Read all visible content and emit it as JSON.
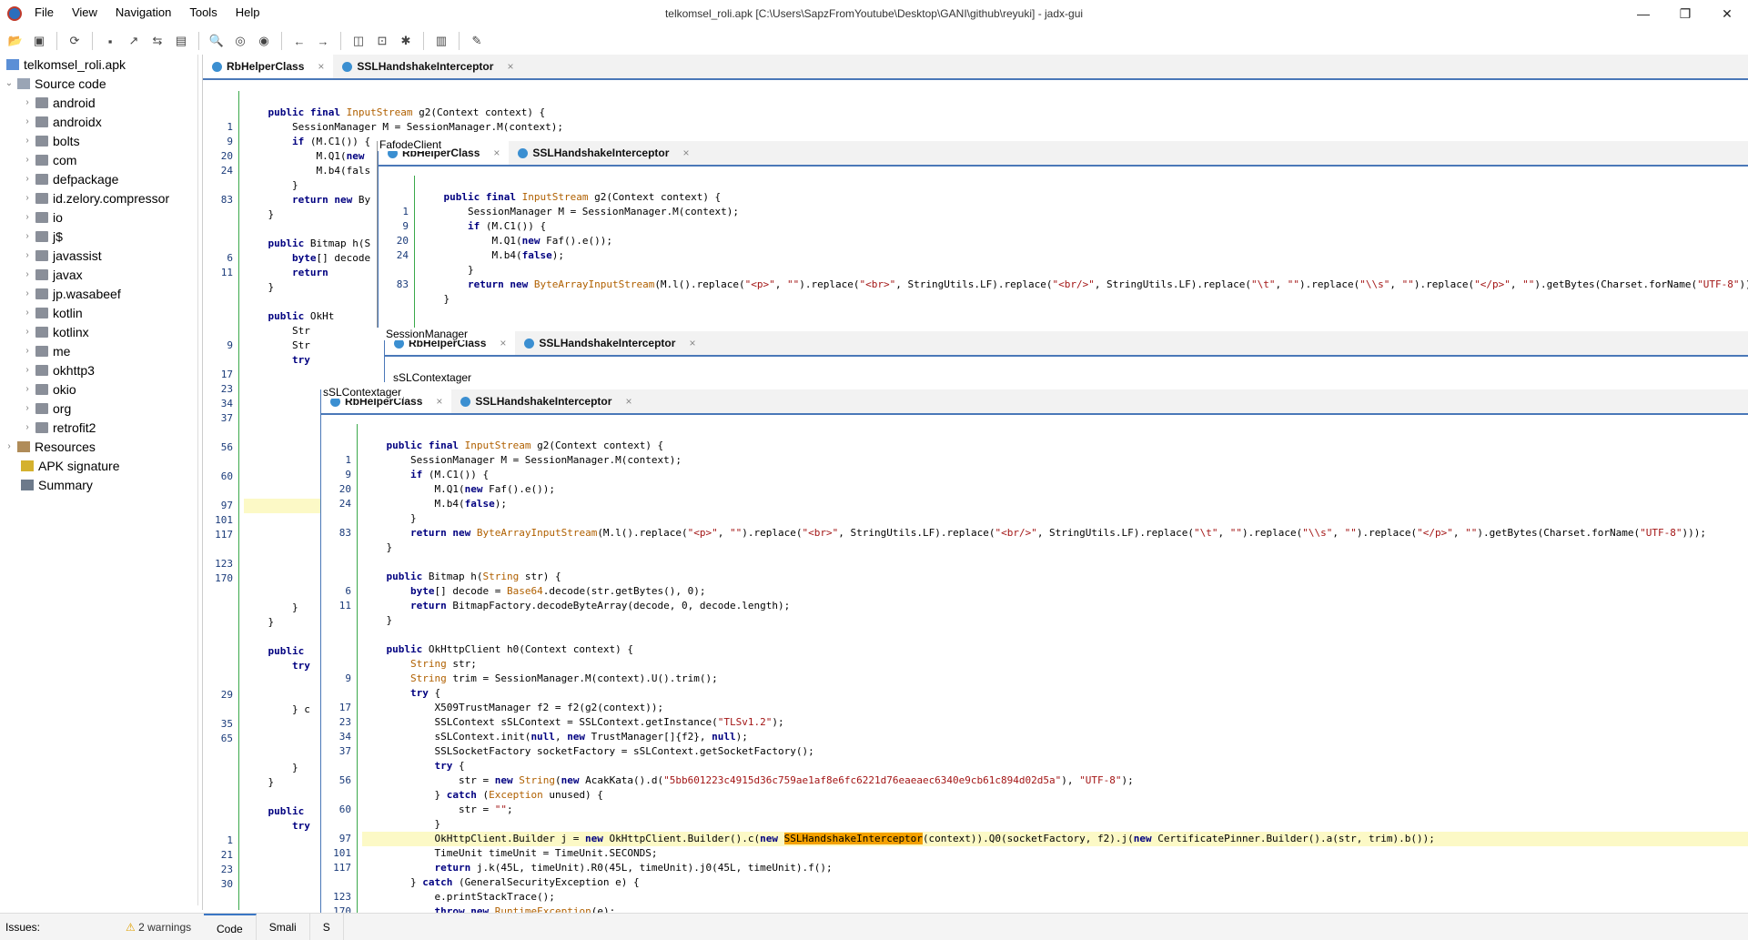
{
  "window": {
    "title": "telkomsel_roli.apk [C:\\Users\\SapzFromYoutube\\Desktop\\GANI\\github\\reyuki] - jadx-gui",
    "minimize": "—",
    "maximize": "❐",
    "close": "✕"
  },
  "menu": [
    "File",
    "View",
    "Navigation",
    "Tools",
    "Help"
  ],
  "tree": {
    "root": "telkomsel_roli.apk",
    "source": "Source code",
    "packages": [
      "android",
      "androidx",
      "bolts",
      "com",
      "defpackage",
      "id.zelory.compressor",
      "io",
      "j$",
      "javassist",
      "javax",
      "jp.wasabeef",
      "kotlin",
      "kotlinx",
      "me",
      "okhttp3",
      "okio",
      "org",
      "retrofit2"
    ],
    "resources": "Resources",
    "signature": "APK signature",
    "summary": "Summary"
  },
  "status": {
    "issues": "Issues:",
    "warnings": "2 warnings",
    "warn_icon": "⚠",
    "tabs": [
      "Code",
      "Smali",
      "S"
    ]
  },
  "tabs": {
    "helper": "RbHelperClass",
    "ssl": "SSLHandshakeInterceptor",
    "close": "×"
  },
  "floating_labels": {
    "fafode": "FafodeClient",
    "session": "SessionManager",
    "sslctx": "sSLContextager",
    "sslctx2": "sSLContextager"
  },
  "code": {
    "lines": [
      {
        "n": "",
        "t": ""
      },
      {
        "n": "",
        "t": "    public final InputStream g2(Context context) {"
      },
      {
        "n": "1",
        "t": "        SessionManager M = SessionManager.M(context);"
      },
      {
        "n": "9",
        "t": "        if (M.C1()) {"
      },
      {
        "n": "20",
        "t": "            M.Q1(new Faf().e());"
      },
      {
        "n": "24",
        "t": "            M.b4(false);"
      },
      {
        "n": "",
        "t": "        }"
      },
      {
        "n": "83",
        "t": "        return new ByteArrayInputStream(M.l().replace(\"<p>\", \"\").replace(\"<br>\", StringUtils.LF).replace(\"<br/>\", StringUtils.LF).replace(\"\\t\", \"\").replace(\"\\\\s\", \"\").replace(\"</p>\", \"\").getBytes(Charset.forName(\"UTF-8\")));"
      },
      {
        "n": "",
        "t": "    }"
      },
      {
        "n": "",
        "t": ""
      },
      {
        "n": "",
        "t": "    public Bitmap h(String str) {"
      },
      {
        "n": "6",
        "t": "        byte[] decode = Base64.decode(str.getBytes(), 0);"
      },
      {
        "n": "11",
        "t": "        return BitmapFactory.decodeByteArray(decode, 0, decode.length);"
      },
      {
        "n": "",
        "t": "    }"
      },
      {
        "n": "",
        "t": ""
      },
      {
        "n": "",
        "t": "    public OkHttpClient h0(Context context) {"
      },
      {
        "n": "",
        "t": "        String str;"
      },
      {
        "n": "9",
        "t": "        String trim = SessionManager.M(context).U().trim();"
      },
      {
        "n": "",
        "t": "        try {"
      },
      {
        "n": "17",
        "t": "            X509TrustManager f2 = f2(g2(context));"
      },
      {
        "n": "23",
        "t": "            SSLContext sSLContext = SSLContext.getInstance(\"TLSv1.2\");"
      },
      {
        "n": "34",
        "t": "            sSLContext.init(null, new TrustManager[]{f2}, null);"
      },
      {
        "n": "37",
        "t": "            SSLSocketFactory socketFactory = sSLContext.getSocketFactory();"
      },
      {
        "n": "",
        "t": "            try {"
      },
      {
        "n": "56",
        "t": "                str = new String(new AcakKata().d(\"5bb601223c4915d36c759ae1af8e6fc6221d76eaeaec6340e9cb61c894d02d5a\"), \"UTF-8\");"
      },
      {
        "n": "",
        "t": "            } catch (Exception unused) {"
      },
      {
        "n": "60",
        "t": "                str = \"\";"
      },
      {
        "n": "",
        "t": "            }"
      },
      {
        "n": "97",
        "t": "            OkHttpClient.Builder j = new OkHttpClient.Builder().c(new SSLHandshakeInterceptor(context)).Q0(socketFactory, f2).j(new CertificatePinner.Builder().a(str, trim).b());"
      },
      {
        "n": "101",
        "t": "            TimeUnit timeUnit = TimeUnit.SECONDS;"
      },
      {
        "n": "117",
        "t": "            return j.k(45L, timeUnit).R0(45L, timeUnit).j0(45L, timeUnit).f();"
      },
      {
        "n": "",
        "t": "        } catch (GeneralSecurityException e) {"
      },
      {
        "n": "123",
        "t": "            e.printStackTrace();"
      },
      {
        "n": "170",
        "t": "            throw new RuntimeException(e);"
      },
      {
        "n": "",
        "t": "        }"
      },
      {
        "n": "",
        "t": "    }"
      }
    ],
    "back_lines_left": [
      {
        "n": "",
        "t": ""
      },
      {
        "n": "",
        "t": "    public final InputStream g2(Context context) {"
      },
      {
        "n": "1",
        "t": "        SessionManager M = SessionManager.M(context);"
      },
      {
        "n": "9",
        "t": "        if (M.C1()) {"
      },
      {
        "n": "20",
        "t": "            M.Q1(new "
      },
      {
        "n": "24",
        "t": "            M.b4(fals"
      },
      {
        "n": "",
        "t": "        }"
      },
      {
        "n": "83",
        "t": "        return new By"
      },
      {
        "n": "",
        "t": "    }"
      },
      {
        "n": "",
        "t": ""
      },
      {
        "n": "",
        "t": "    public Bitmap h(S"
      },
      {
        "n": "6",
        "t": "        byte[] decode"
      },
      {
        "n": "11",
        "t": "        return"
      },
      {
        "n": "",
        "t": "    }"
      },
      {
        "n": "",
        "t": ""
      },
      {
        "n": "",
        "t": "    public OkHt"
      },
      {
        "n": "",
        "t": "        Str"
      },
      {
        "n": "9",
        "t": "        Str"
      },
      {
        "n": "",
        "t": "        try"
      },
      {
        "n": "17",
        "t": ""
      },
      {
        "n": "23",
        "t": ""
      },
      {
        "n": "34",
        "t": ""
      },
      {
        "n": "37",
        "t": ""
      },
      {
        "n": "",
        "t": ""
      },
      {
        "n": "56",
        "t": ""
      },
      {
        "n": "",
        "t": ""
      },
      {
        "n": "60",
        "t": ""
      },
      {
        "n": "",
        "t": ""
      },
      {
        "n": "97",
        "t": ""
      },
      {
        "n": "101",
        "t": ""
      },
      {
        "n": "117",
        "t": ""
      },
      {
        "n": "",
        "t": ""
      },
      {
        "n": "123",
        "t": ""
      },
      {
        "n": "170",
        "t": ""
      },
      {
        "n": "",
        "t": ""
      },
      {
        "n": "",
        "t": "        }"
      },
      {
        "n": "",
        "t": "    }"
      },
      {
        "n": "",
        "t": ""
      },
      {
        "n": "",
        "t": "    public"
      },
      {
        "n": "",
        "t": "        try"
      },
      {
        "n": "",
        "t": ""
      },
      {
        "n": "29",
        "t": ""
      },
      {
        "n": "",
        "t": "        } c"
      },
      {
        "n": "35",
        "t": ""
      },
      {
        "n": "65",
        "t": ""
      },
      {
        "n": "",
        "t": ""
      },
      {
        "n": "",
        "t": "        }"
      },
      {
        "n": "",
        "t": "    }"
      },
      {
        "n": "",
        "t": ""
      },
      {
        "n": "",
        "t": "    public"
      },
      {
        "n": "",
        "t": "        try"
      },
      {
        "n": "1",
        "t": ""
      },
      {
        "n": "21",
        "t": ""
      },
      {
        "n": "23",
        "t": ""
      },
      {
        "n": "30",
        "t": ""
      }
    ]
  }
}
